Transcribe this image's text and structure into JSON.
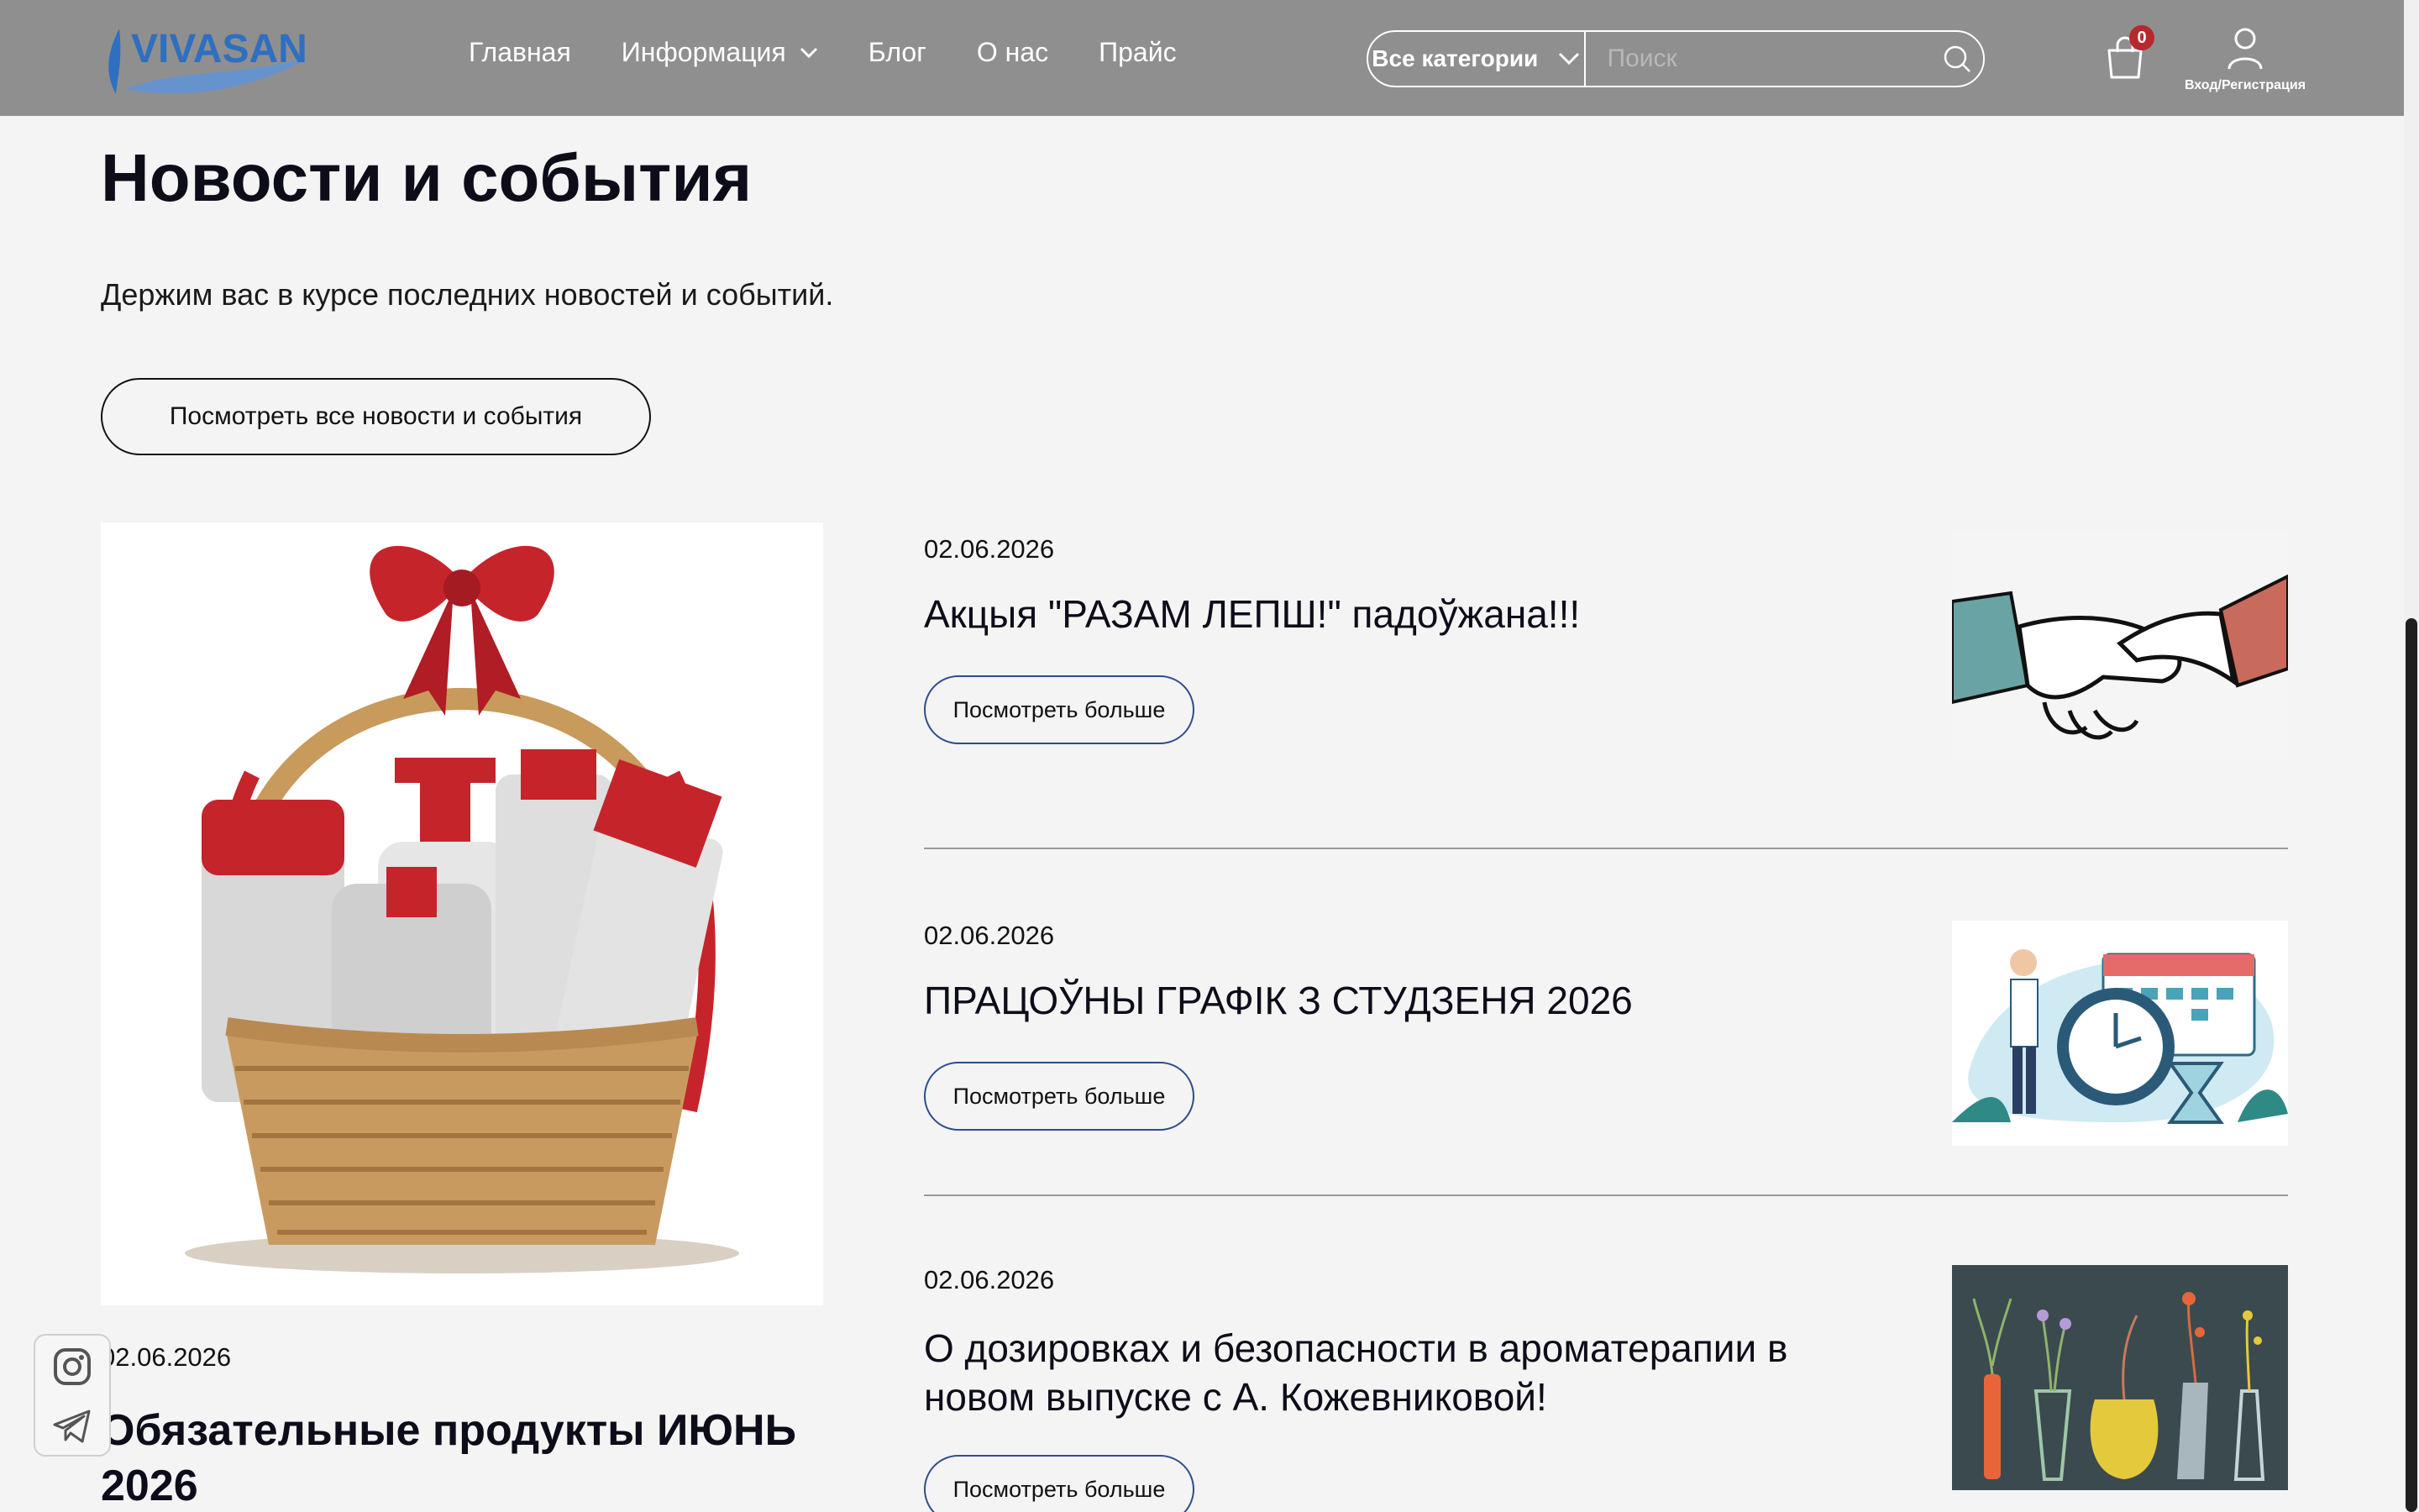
{
  "brand": {
    "logo_text": "VIVASAN"
  },
  "nav": {
    "items": [
      {
        "label": "Главная"
      },
      {
        "label": "Информация",
        "has_dropdown": true
      },
      {
        "label": "Блог"
      },
      {
        "label": "О нас"
      },
      {
        "label": "Прайс"
      }
    ]
  },
  "search": {
    "category_label": "Все категории",
    "placeholder": "Поиск",
    "value": ""
  },
  "cart": {
    "count": "0"
  },
  "account": {
    "label": "Вход/Регистрация"
  },
  "section": {
    "title": "Новости и события",
    "subtitle": "Держим вас в курсе последних новостей и событий.",
    "all_button": "Посмотреть все новости и события"
  },
  "featured": {
    "date": "02.06.2026",
    "title": "Обязательные продукты ИЮНЬ 2026"
  },
  "news": [
    {
      "date": "02.06.2026",
      "title": "Акцыя \"РАЗАМ ЛЕПШ!\" падоўжана!!!",
      "button": "Посмотреть больше"
    },
    {
      "date": "02.06.2026",
      "title": "ПРАЦОЎНЫ ГРАФІК З СТУДЗЕНЯ 2026",
      "button": "Посмотреть больше"
    },
    {
      "date": "02.06.2026",
      "title": "О дозировках и безопасности в ароматерапии в новом выпуске с А. Кожевниковой!",
      "button": "Посмотреть больше"
    }
  ],
  "colors": {
    "header_bg": "#8f8f8f",
    "page_bg": "#f4f4f4",
    "badge": "#b7282e",
    "button_border": "#2d4e8a",
    "logo_blue": "#2f6fc0"
  },
  "icons": [
    "chevron-down-icon",
    "search-icon",
    "cart-icon",
    "user-icon",
    "instagram-icon",
    "telegram-icon"
  ]
}
